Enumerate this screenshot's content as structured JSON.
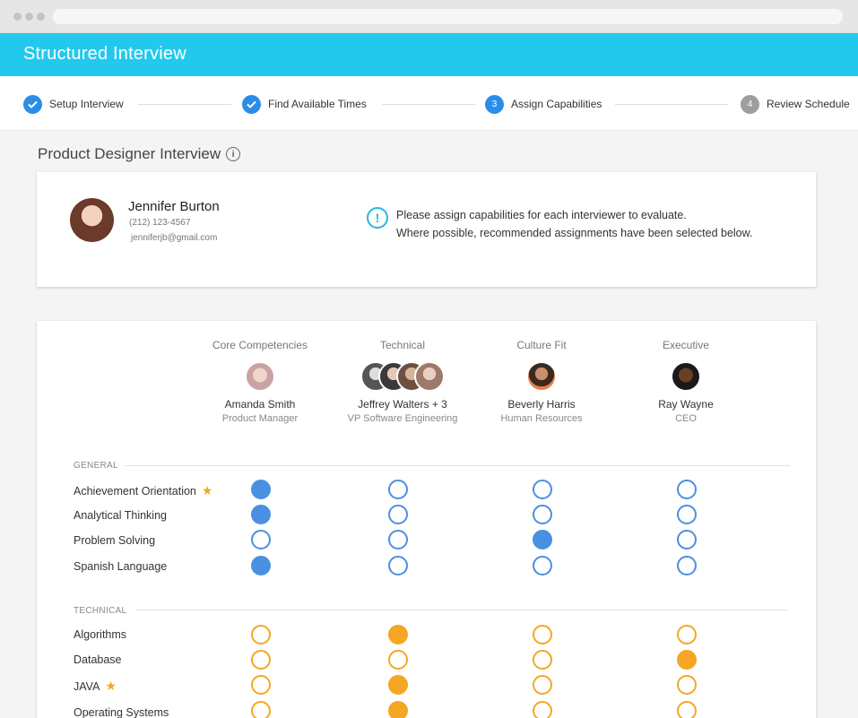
{
  "app": {
    "title": "Structured Interview"
  },
  "stepper": [
    {
      "label": "Setup Interview",
      "status": "done"
    },
    {
      "label": "Find Available Times",
      "status": "done"
    },
    {
      "label": "Assign Capabilities",
      "status": "current",
      "number": "3"
    },
    {
      "label": "Review Schedule",
      "status": "pending",
      "number": "4"
    }
  ],
  "page": {
    "title": "Product Designer Interview"
  },
  "candidate": {
    "name": "Jennifer Burton",
    "phone": "(212) 123-4567",
    "email": "jenniferjb@gmail.com"
  },
  "notice": {
    "line1": "Please assign capabilities for each interviewer to evaluate.",
    "line2": "Where possible, recommended assignments have been selected below."
  },
  "columns": [
    {
      "title": "Core Competencies",
      "name": "Amanda Smith",
      "role": "Product Manager"
    },
    {
      "title": "Technical",
      "name": "Jeffrey Walters + 3",
      "role": "VP Software Engineering"
    },
    {
      "title": "Culture Fit",
      "name": "Beverly Harris",
      "role": "Human Resources"
    },
    {
      "title": "Executive",
      "name": "Ray Wayne",
      "role": "CEO"
    }
  ],
  "sections": [
    {
      "label": "GENERAL",
      "color": "#4a90e2",
      "rows": [
        {
          "label": "Achievement Orientation",
          "starred": true,
          "selected": 0
        },
        {
          "label": "Analytical Thinking",
          "starred": false,
          "selected": 0
        },
        {
          "label": "Problem Solving",
          "starred": false,
          "selected": 2
        },
        {
          "label": "Spanish Language",
          "starred": false,
          "selected": 0
        }
      ]
    },
    {
      "label": "TECHNICAL",
      "color": "#f5a623",
      "rows": [
        {
          "label": "Algorithms",
          "starred": false,
          "selected": 1
        },
        {
          "label": "Database",
          "starred": false,
          "selected": 3
        },
        {
          "label": "JAVA",
          "starred": true,
          "selected": 1
        },
        {
          "label": "Operating Systems",
          "starred": false,
          "selected": 1
        }
      ]
    }
  ],
  "icons": {
    "step_done": "checkmark-icon",
    "info": "info-icon",
    "notice": "exclamation-icon",
    "star": "star-icon"
  }
}
